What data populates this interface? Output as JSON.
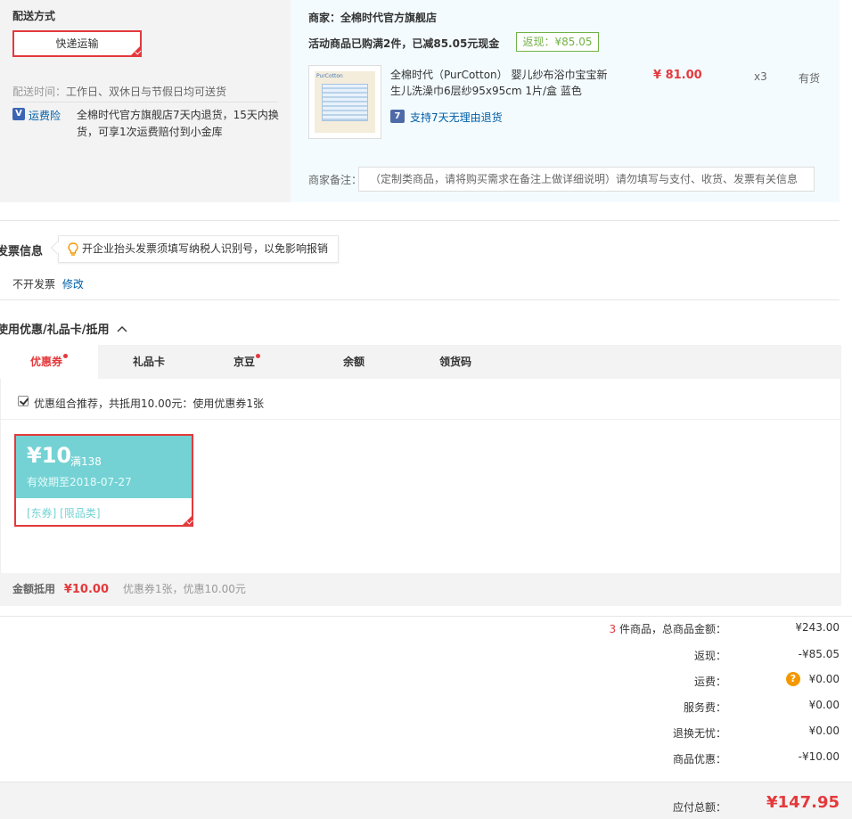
{
  "shipping": {
    "title": "配送方式",
    "method_button": "快递运输",
    "time_label": "配送时间：",
    "time_value": "工作日、双休日与节假日均可送货",
    "insurance_icon": "V",
    "insurance_label": "运费险",
    "insurance_line1": "全棉时代官方旗舰店7天内退货，15天内换",
    "insurance_line2": "货，可享1次运费赔付到小金库"
  },
  "merchant": {
    "label": "商家：",
    "name": "全棉时代官方旗舰店",
    "promo": "活动商品已购满2件，已减85.05元现金",
    "cashback_badge": "返现：¥85.05",
    "product": {
      "thumb_brand": "PurCotton",
      "title_line1": "全棉时代（PurCotton） 婴儿纱布浴巾宝宝新",
      "title_line2": "生儿洗澡巾6层纱95x95cm 1片/盒 蓝色",
      "price": "¥ 81.00",
      "qty": "x3",
      "stock": "有货",
      "return_icon": "7",
      "return_policy": "支持7天无理由退货"
    },
    "remark_label": "商家备注：",
    "remark_placeholder": "（定制类商品，请将购买需求在备注上做详细说明）请勿填写与支付、收货、发票有关信息"
  },
  "invoice": {
    "title": "发票信息",
    "tip": "开企业抬头发票须填写纳税人识别号，以免影响报销",
    "status": "不开发票",
    "modify_link": "修改"
  },
  "discount": {
    "title": "使用优惠/礼品卡/抵用",
    "tabs": [
      {
        "label": "优惠券",
        "dot": true
      },
      {
        "label": "礼品卡",
        "dot": false
      },
      {
        "label": "京豆",
        "dot": true
      },
      {
        "label": "余额",
        "dot": false
      },
      {
        "label": "领货码",
        "dot": false
      }
    ],
    "combo_text": "优惠组合推荐，共抵用10.00元：使用优惠券1张",
    "coupon": {
      "amount": "¥10",
      "condition": "满138",
      "validity": "有效期至2018-07-27",
      "tags": "[东券]  [限品类]"
    },
    "amount_label": "金额抵用",
    "amount_value": "¥10.00",
    "amount_detail": "优惠券1张，优惠10.00元"
  },
  "summary": {
    "count": "3",
    "count_suffix": " 件商品，总商品金额：",
    "goods_total": "¥243.00",
    "rows": [
      {
        "label": "返现：",
        "value": "-¥85.05"
      },
      {
        "label": "运费：",
        "value": "¥0.00"
      },
      {
        "label": "服务费：",
        "value": "¥0.00"
      },
      {
        "label": "退换无忧：",
        "value": "¥0.00"
      },
      {
        "label": "商品优惠：",
        "value": "-¥10.00"
      }
    ],
    "freight_help_icon": "?",
    "payable_label": "应付总额：",
    "payable_value": "¥147.95"
  },
  "colors": {
    "accent_red": "#e4393c",
    "coupon_teal": "#74d2d4",
    "cashback_green": "#71b247",
    "link_blue": "#005ea7"
  }
}
